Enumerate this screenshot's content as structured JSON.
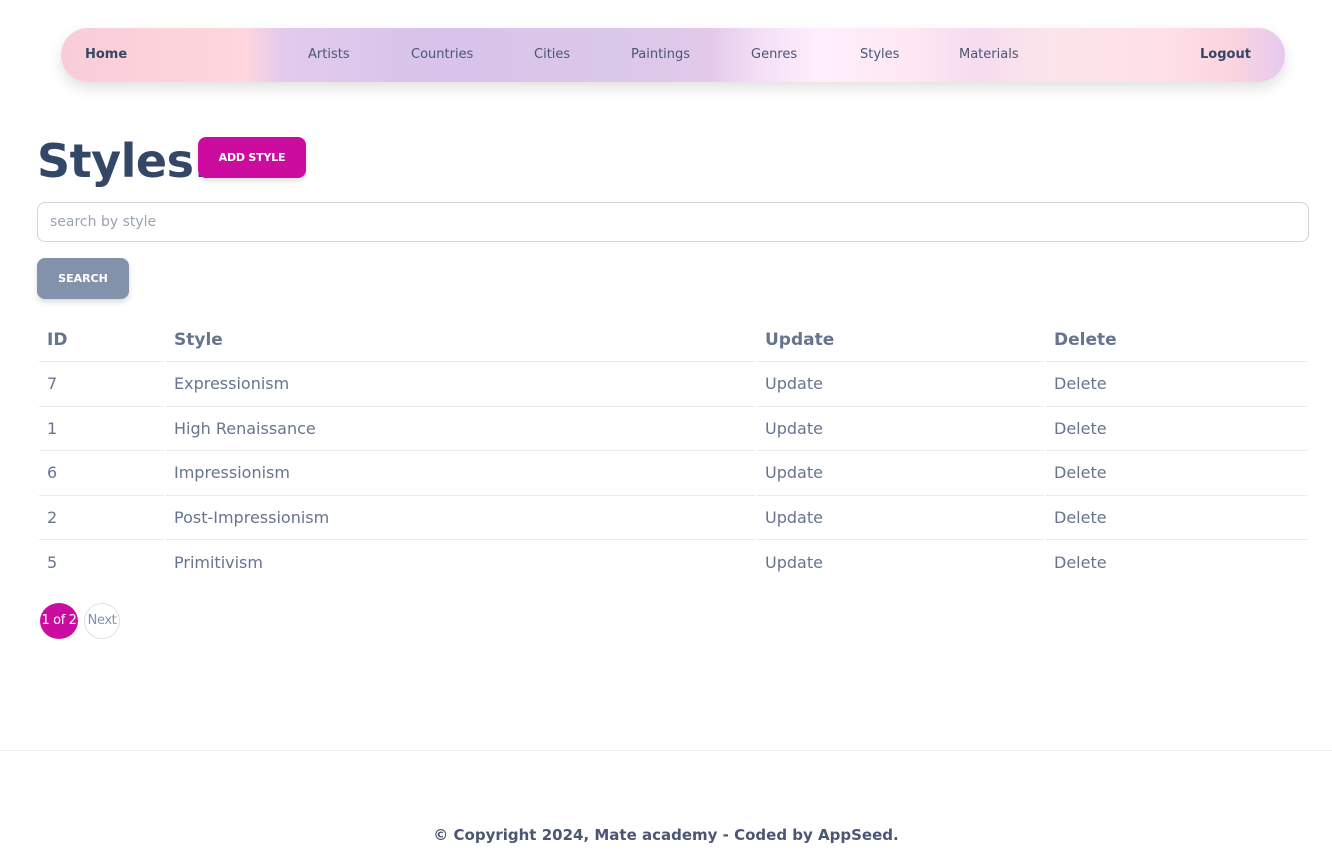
{
  "nav": {
    "home": "Home",
    "artists": "Artists",
    "countries": "Countries",
    "cities": "Cities",
    "paintings": "Paintings",
    "genres": "Genres",
    "styles": "Styles",
    "materials": "Materials",
    "logout": "Logout"
  },
  "page": {
    "title": "Styles:",
    "add_button": "ADD STYLE",
    "search_placeholder": "search by style",
    "search_value": "",
    "search_button": "SEARCH"
  },
  "table": {
    "headers": [
      "ID",
      "Style",
      "Update",
      "Delete"
    ],
    "rows": [
      {
        "id": "7",
        "style": "Expressionism",
        "update": "Update",
        "delete": "Delete"
      },
      {
        "id": "1",
        "style": "High Renaissance",
        "update": "Update",
        "delete": "Delete"
      },
      {
        "id": "6",
        "style": "Impressionism",
        "update": "Update",
        "delete": "Delete"
      },
      {
        "id": "2",
        "style": "Post-Impressionism",
        "update": "Update",
        "delete": "Delete"
      },
      {
        "id": "5",
        "style": "Primitivism",
        "update": "Update",
        "delete": "Delete"
      }
    ]
  },
  "pagination": {
    "current": "1 of 2",
    "next": "Next"
  },
  "footer": {
    "text": "© Copyright 2024, Mate academy - Coded by AppSeed."
  },
  "colors": {
    "primary": "#cb0c9f",
    "secondary": "#8392ab",
    "danger": "#d32424",
    "heading": "#344767"
  }
}
